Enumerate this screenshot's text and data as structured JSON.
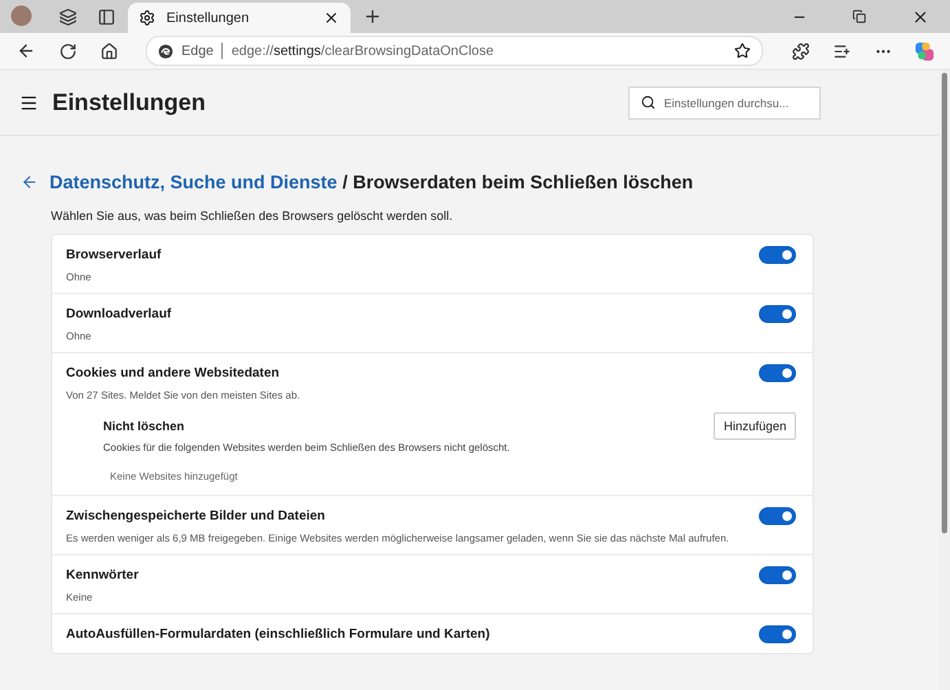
{
  "tab": {
    "title": "Einstellungen"
  },
  "address": {
    "site_label": "Edge",
    "url": "edge://**settings**/clearBrowsingDataOnClose"
  },
  "header": {
    "title": "Einstellungen",
    "search": {
      "placeholder": "Einstellungen durchsu..."
    }
  },
  "breadcrumb": {
    "parent": "Datenschutz, Suche und Dienste",
    "separator": "/",
    "current": "Browserdaten beim Schließen löschen"
  },
  "description": "Wählen Sie aus, was beim Schließen des Browsers gelöscht werden soll.",
  "items": [
    {
      "kind": "toggle",
      "title": "Browserverlauf",
      "subtitle": "Ohne",
      "on": true
    },
    {
      "kind": "toggle",
      "title": "Downloadverlauf",
      "subtitle": "Ohne",
      "on": true
    },
    {
      "kind": "cookies",
      "title": "Cookies und andere Websitedaten",
      "subtitle": "Von 27 Sites. Meldet Sie von den meisten Sites ab.",
      "on": true,
      "exceptions": {
        "title": "Nicht löschen",
        "description": "Cookies für die folgenden Websites werden beim Schließen des Browsers nicht gelöscht.",
        "button": "Hinzufügen",
        "empty": "Keine Websites hinzugefügt"
      }
    },
    {
      "kind": "toggle",
      "title": "Zwischengespeicherte Bilder und Dateien",
      "subtitle": "Es werden weniger als 6,9 MB freigegeben. Einige Websites werden möglicherweise langsamer geladen, wenn Sie sie das nächste Mal aufrufen.",
      "on": true
    },
    {
      "kind": "toggle",
      "title": "Kennwörter",
      "subtitle": "Keine",
      "on": true
    },
    {
      "kind": "toggle",
      "title": "AutoAusfüllen-Formulardaten (einschließlich Formulare und Karten)",
      "on": true
    }
  ]
}
